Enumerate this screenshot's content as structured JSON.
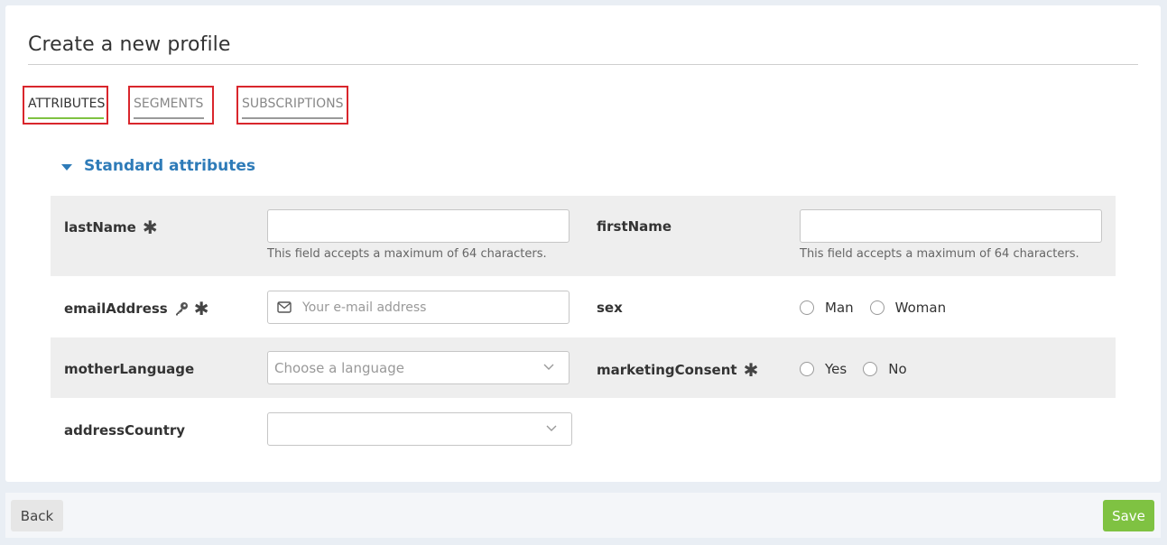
{
  "page": {
    "title": "Create a new profile"
  },
  "tabs": [
    {
      "label": "ATTRIBUTES",
      "active": true
    },
    {
      "label": "SEGMENTS",
      "active": false
    },
    {
      "label": "SUBSCRIPTIONS",
      "active": false
    }
  ],
  "section": {
    "title": "Standard attributes"
  },
  "fields": {
    "lastName": {
      "label": "lastName",
      "value": "",
      "hint": "This field accepts a maximum of 64 characters."
    },
    "firstName": {
      "label": "firstName",
      "value": "",
      "hint": "This field accepts a maximum of 64 characters."
    },
    "emailAddress": {
      "label": "emailAddress",
      "value": "",
      "placeholder": "Your e-mail address"
    },
    "sex": {
      "label": "sex",
      "options": [
        "Man",
        "Woman"
      ]
    },
    "motherLanguage": {
      "label": "motherLanguage",
      "placeholder": "Choose a language"
    },
    "marketingConsent": {
      "label": "marketingConsent",
      "options": [
        "Yes",
        "No"
      ]
    },
    "addressCountry": {
      "label": "addressCountry",
      "value": ""
    }
  },
  "required_mark": "✱",
  "footer": {
    "back_label": "Back",
    "save_label": "Save"
  },
  "colors": {
    "accent_blue": "#2e7bb8",
    "accent_green": "#7fc242",
    "highlight_red": "#d9262c"
  }
}
